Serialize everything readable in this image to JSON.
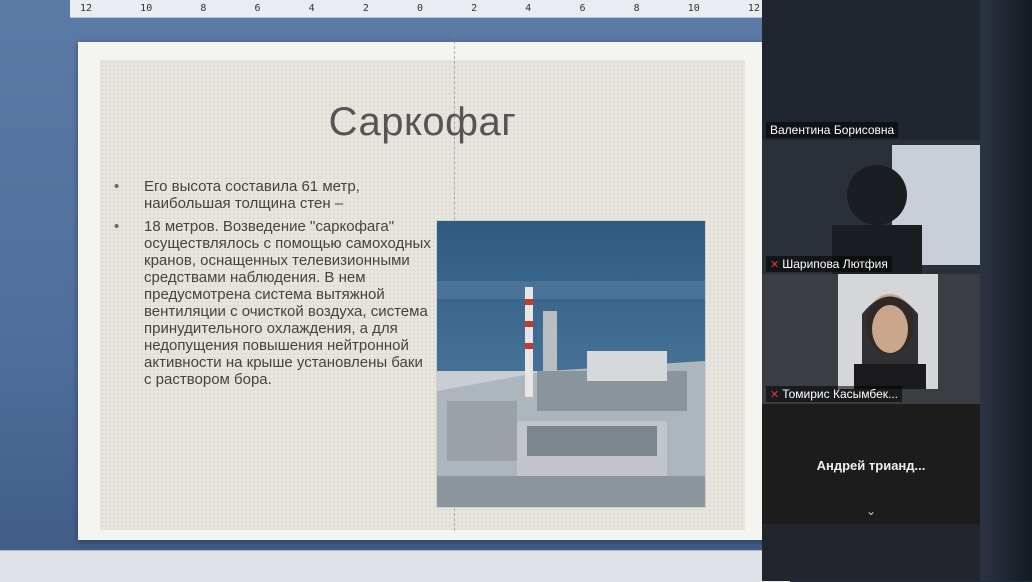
{
  "ruler": {
    "ticks": [
      "12",
      "10",
      "8",
      "6",
      "4",
      "2",
      "0",
      "2",
      "4",
      "6",
      "8",
      "10",
      "12"
    ]
  },
  "slide": {
    "title": "Саркофаг",
    "bullets": [
      "Его высота составила 61 метр, наибольшая толщина стен –",
      "18 метров. Возведение \"саркофага\" осуществлялось с помощью самоходных кранов, оснащенных телевизионными средствами наблюдения. В нем предусмотрена система вытяжной вентиляции с очисткой воздуха, система принудительного охлаждения, а для недопущения повышения нейтронной активности на крыше установлены баки с раствором бора."
    ]
  },
  "participants": [
    {
      "name": "Валентина Борисовна",
      "muted": false
    },
    {
      "name": "Шарипова Лютфия",
      "muted": true
    },
    {
      "name": "Томирис Касымбек...",
      "muted": true
    },
    {
      "name": "Андрей  трианд...",
      "muted": false
    }
  ],
  "colors": {
    "editor_bg": "#4f6e9b",
    "mic_muted": "#e53935"
  }
}
